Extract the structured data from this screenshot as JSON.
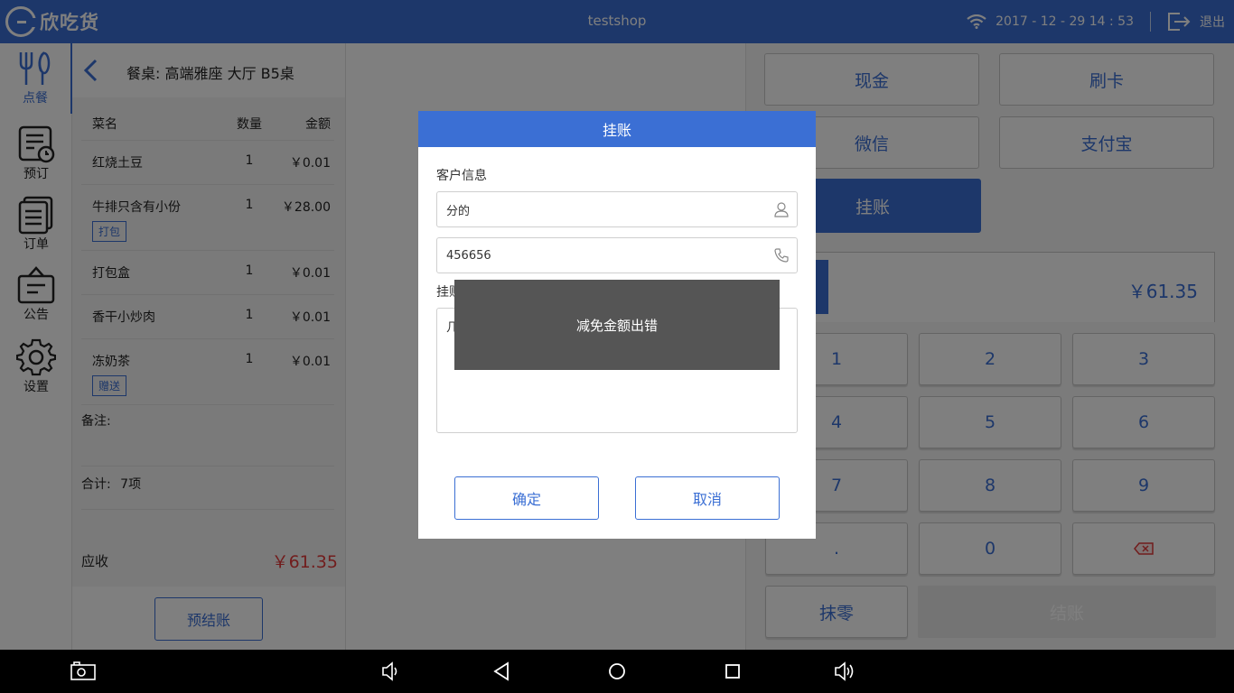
{
  "header": {
    "logo_text": "欣吃货",
    "shop_name": "testshop",
    "datetime": "2017 - 12 - 29  14 : 53",
    "logout_label": "退出"
  },
  "nav": {
    "items": [
      {
        "label": "点餐",
        "icon": "fork-knife-icon",
        "active": true
      },
      {
        "label": "预订",
        "icon": "reservation-icon",
        "active": false
      },
      {
        "label": "订单",
        "icon": "orders-icon",
        "active": false
      },
      {
        "label": "公告",
        "icon": "announcement-icon",
        "active": false
      },
      {
        "label": "设置",
        "icon": "gear-icon",
        "active": false
      }
    ]
  },
  "order": {
    "table_title": "餐桌: 高端雅座 大厅 B5桌",
    "columns": {
      "name": "菜名",
      "qty": "数量",
      "amount": "金额"
    },
    "items": [
      {
        "name": "红烧土豆",
        "qty": "1",
        "amount": "￥0.01",
        "tag": ""
      },
      {
        "name": "牛排只含有小份",
        "qty": "1",
        "amount": "￥28.00",
        "tag": "打包"
      },
      {
        "name": "打包盒",
        "qty": "1",
        "amount": "￥0.01",
        "tag": ""
      },
      {
        "name": "香干小炒肉",
        "qty": "1",
        "amount": "￥0.01",
        "tag": ""
      },
      {
        "name": "冻奶茶",
        "qty": "1",
        "amount": "￥0.01",
        "tag": "赠送"
      }
    ],
    "remark_label": "备注:",
    "total_label": "合计:",
    "total_count": "7项",
    "receivable_label": "应收",
    "receivable_value": "￥61.35",
    "pre_checkout_label": "预结账"
  },
  "payment": {
    "methods": [
      {
        "label": "现金",
        "selected": false
      },
      {
        "label": "刷卡",
        "selected": false
      },
      {
        "label": "微信",
        "selected": false
      },
      {
        "label": "支付宝",
        "selected": false
      },
      {
        "label": "挂账",
        "selected": true
      }
    ],
    "amount": "￥61.35",
    "keys": [
      "1",
      "2",
      "3",
      "4",
      "5",
      "6",
      "7",
      "8",
      "9",
      ".",
      "0"
    ],
    "round_off_label": "抹零",
    "checkout_label": "结账"
  },
  "dialog": {
    "title": "挂账",
    "customer_label": "客户信息",
    "name_value": "分的",
    "phone_value": "456656",
    "reason_label": "挂账原因",
    "reason_value": "几",
    "confirm_label": "确定",
    "cancel_label": "取消"
  },
  "toast": {
    "message": "减免金额出错"
  },
  "colors": {
    "primary": "#3b6fd4",
    "price_red": "#e23b3b",
    "toast_bg": "#555555"
  }
}
